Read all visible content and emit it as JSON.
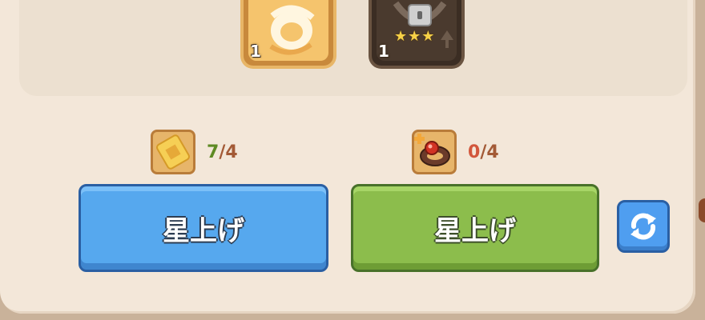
{
  "items": [
    {
      "count": "1",
      "icon": "gold-ring-icon",
      "locked": false
    },
    {
      "count": "1",
      "icon": "lock-icon",
      "locked": true,
      "stars": "★★★"
    }
  ],
  "costs": [
    {
      "icon": "gold-ticket-icon",
      "have": "7",
      "sep": "/",
      "need": "4"
    },
    {
      "icon": "red-gem-ring-icon",
      "have": "0",
      "sep": "/",
      "need": "4"
    }
  ],
  "buttons": {
    "left_label": "星上げ",
    "right_label": "星上げ"
  },
  "colors": {
    "blue_button": "#56a8ee",
    "green_button": "#8cbd4c",
    "panel": "#f3e7d9"
  }
}
